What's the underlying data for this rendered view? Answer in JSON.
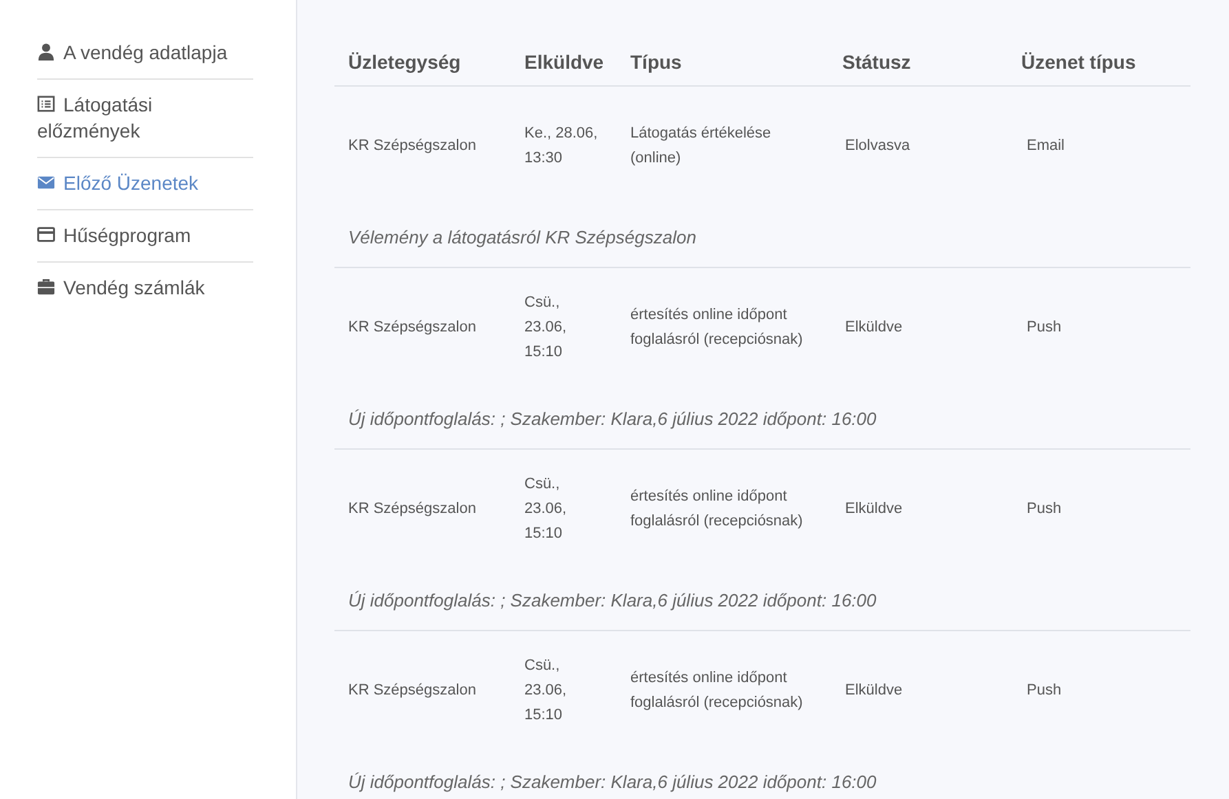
{
  "sidebar": {
    "items": [
      {
        "label": "A vendég adatlapja",
        "kind": "user",
        "selected": false
      },
      {
        "label": "Látogatási\nelőzmények",
        "kind": "list",
        "selected": false
      },
      {
        "label": "Előző Üzenetek",
        "kind": "mail",
        "selected": true
      },
      {
        "label": "Hűségprogram",
        "kind": "card",
        "selected": false
      },
      {
        "label": "Vendég számlák",
        "kind": "briefcase",
        "selected": false
      }
    ]
  },
  "table": {
    "columns": [
      "Üzletegység",
      "Elküldve",
      "Típus",
      "Státusz",
      "Üzenet típus"
    ],
    "rows": [
      {
        "unit": "KR Szépségszalon",
        "sent": "Ke., 28.06,\n13:30",
        "type": "Látogatás értékelése\n(online)",
        "status": "Elolvasva",
        "message_type": "Email",
        "message": "Vélemény a látogatásról KR Szépségszalon"
      },
      {
        "unit": "KR Szépségszalon",
        "sent": "Csü.,\n23.06,\n15:10",
        "type": "értesítés online időpont\nfoglalásról (recepciósnak)",
        "status": "Elküldve",
        "message_type": "Push",
        "message": "Új időpontfoglalás: ; Szakember: Klara,6 július 2022 időpont: 16:00"
      },
      {
        "unit": "KR Szépségszalon",
        "sent": "Csü.,\n23.06,\n15:10",
        "type": "értesítés online időpont\nfoglalásról (recepciósnak)",
        "status": "Elküldve",
        "message_type": "Push",
        "message": "Új időpontfoglalás: ; Szakember: Klara,6 július 2022 időpont: 16:00"
      },
      {
        "unit": "KR Szépségszalon",
        "sent": "Csü.,\n23.06,\n15:10",
        "type": "értesítés online időpont\nfoglalásról (recepciósnak)",
        "status": "Elküldve",
        "message_type": "Push",
        "message": "Új időpontfoglalás: ; Szakember: Klara,6 július 2022 időpont: 16:00"
      }
    ]
  }
}
